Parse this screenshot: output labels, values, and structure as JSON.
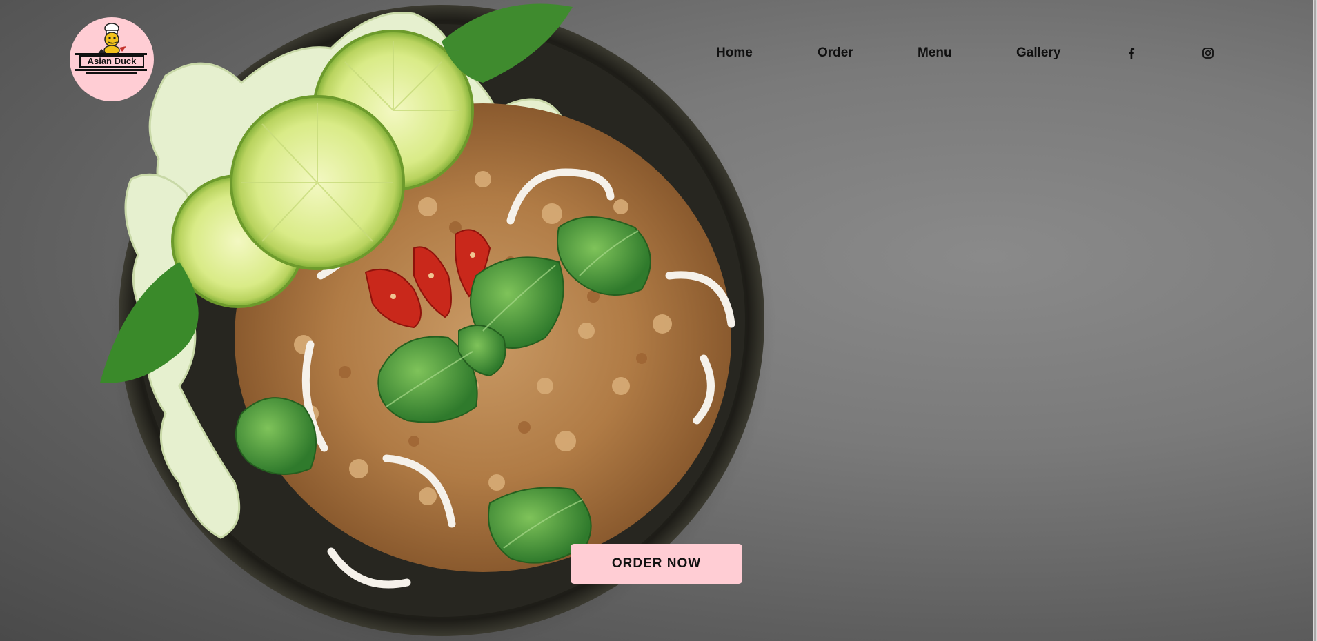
{
  "brand": {
    "logo_text": "Asian Duck",
    "logo_icon": "duck-chef-icon",
    "logo_bg": "#ffcdd4"
  },
  "nav": {
    "items": [
      {
        "label": "Home"
      },
      {
        "label": "Order"
      },
      {
        "label": "Menu"
      },
      {
        "label": "Gallery"
      }
    ],
    "social": [
      {
        "icon": "facebook-icon"
      },
      {
        "icon": "instagram-icon"
      }
    ]
  },
  "hero": {
    "cta_label": "ORDER NOW",
    "cta_color": "#ffcdd4",
    "image": "bowl-of-larb-salad-with-lime-mint-and-chili"
  }
}
